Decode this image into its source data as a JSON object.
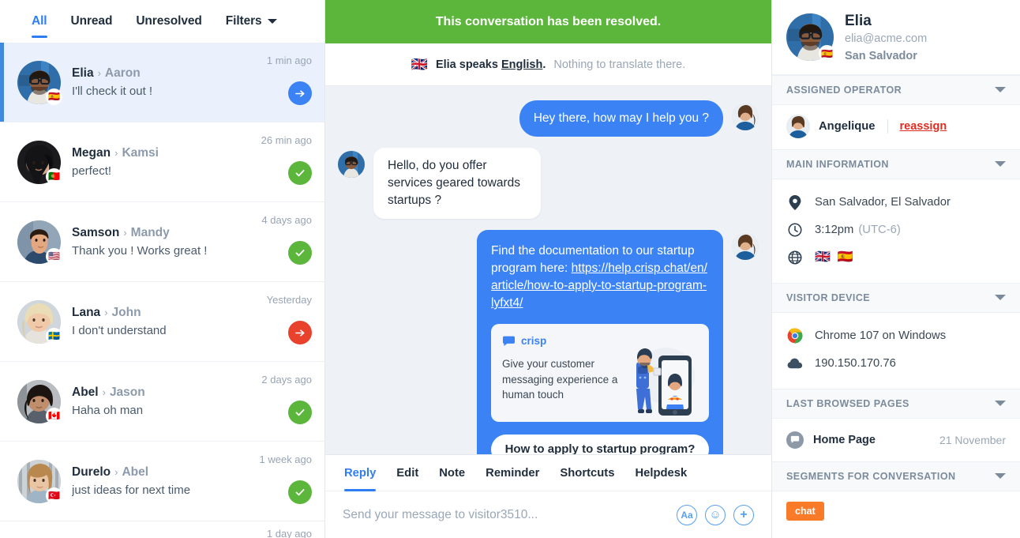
{
  "list": {
    "tabs": [
      {
        "label": "All",
        "active": true
      },
      {
        "label": "Unread",
        "active": false
      },
      {
        "label": "Unresolved",
        "active": false
      },
      {
        "label": "Filters",
        "active": false,
        "caret": true
      }
    ],
    "conversations": [
      {
        "from": "Elia",
        "sep": "›",
        "to": "Aaron",
        "preview": "I'll check it out !",
        "time": "1 min ago",
        "badge": "blue",
        "flag": "🇪🇸",
        "selected": true
      },
      {
        "from": "Megan",
        "sep": "›",
        "to": "Kamsi",
        "preview": "perfect!",
        "time": "26 min ago",
        "badge": "green",
        "flag": "🇵🇹",
        "selected": false
      },
      {
        "from": "Samson",
        "sep": "›",
        "to": "Mandy",
        "preview": "Thank you ! Works great !",
        "time": "4 days ago",
        "badge": "green",
        "flag": "🇺🇸",
        "selected": false
      },
      {
        "from": "Lana",
        "sep": "›",
        "to": "John",
        "preview": "I don't understand",
        "time": "Yesterday",
        "badge": "red",
        "flag": "🇸🇪",
        "selected": false
      },
      {
        "from": "Abel",
        "sep": "›",
        "to": "Jason",
        "preview": "Haha oh man",
        "time": "2 days ago",
        "badge": "green",
        "flag": "🇨🇦",
        "selected": false
      },
      {
        "from": "Durelo",
        "sep": "›",
        "to": "Abel",
        "preview": "just ideas for next time",
        "time": "1 week ago",
        "badge": "green",
        "flag": "🇹🇷",
        "selected": false
      }
    ],
    "next_partial_time": "1 day ago"
  },
  "chat": {
    "resolved_banner": "This conversation has been resolved.",
    "translate": {
      "flag": "🇬🇧",
      "main_prefix": "Elia speaks ",
      "language": "English",
      "main_suffix": ".",
      "sub": "Nothing to translate there."
    },
    "messages": [
      {
        "dir": "out",
        "type": "text",
        "text": "Hey there, how may I help you ?"
      },
      {
        "dir": "in",
        "type": "text",
        "text": "Hello, do you offer services geared towards startups ?"
      }
    ],
    "rich_message": {
      "dir": "out",
      "text_prefix": "Find the documentation to our startup program here: ",
      "link": "https://help.crisp.chat/en/article/how-to-apply-to-startup-program-lyfxt4/",
      "card": {
        "brand": "crisp",
        "text": "Give your customer messaging experience a human touch"
      },
      "cta": "How to apply to startup program?"
    },
    "composer": {
      "tabs": [
        {
          "label": "Reply",
          "active": true
        },
        {
          "label": "Edit",
          "active": false
        },
        {
          "label": "Note",
          "active": false
        },
        {
          "label": "Reminder",
          "active": false
        },
        {
          "label": "Shortcuts",
          "active": false
        },
        {
          "label": "Helpdesk",
          "active": false
        }
      ],
      "placeholder": "Send your message to visitor3510...",
      "tools": [
        {
          "name": "text-format-icon",
          "glyph": "Aa"
        },
        {
          "name": "emoji-icon",
          "glyph": "☺"
        },
        {
          "name": "attachment-add-icon",
          "glyph": "+"
        }
      ]
    }
  },
  "sidebar": {
    "profile": {
      "name": "Elia",
      "email": "elia@acme.com",
      "location": "San Salvador",
      "flag": "🇪🇸"
    },
    "sections": [
      {
        "title": "ASSIGNED OPERATOR"
      },
      {
        "title": "MAIN INFORMATION"
      },
      {
        "title": "VISITOR DEVICE"
      },
      {
        "title": "LAST BROWSED PAGES"
      },
      {
        "title": "SEGMENTS FOR CONVERSATION"
      }
    ],
    "operator": {
      "name": "Angelique",
      "reassign_label": "reassign"
    },
    "main_info": {
      "location": "San Salvador, El Salvador",
      "time": "3:12pm",
      "timezone": "(UTC-6)",
      "languages": [
        "🇬🇧",
        "🇪🇸"
      ]
    },
    "device": {
      "browser": "Chrome 107 on Windows",
      "ip": "190.150.170.76"
    },
    "browsed_pages": [
      {
        "name": "Home Page",
        "date": "21 November"
      }
    ],
    "segments": [
      "chat"
    ]
  },
  "colors": {
    "accent_blue": "#3b82f5",
    "resolved_green": "#5cb63c",
    "alert_red": "#e8412c",
    "segment_orange": "#f97a28",
    "chat_bg": "#eef1f6"
  }
}
